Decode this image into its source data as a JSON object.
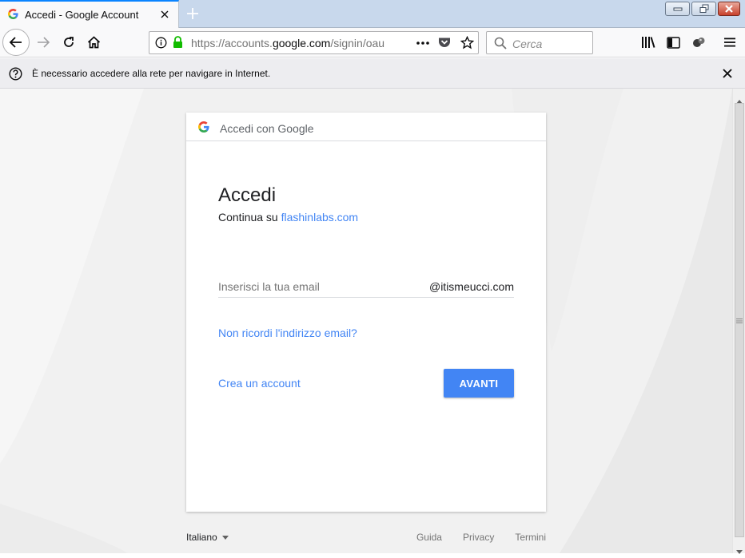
{
  "browser": {
    "tab": {
      "title": "Accedi - Google Account"
    },
    "url": {
      "prefix": "https://accounts.",
      "host": "google.com",
      "path": "/signin/oauth"
    },
    "search_placeholder": "Cerca",
    "notification": "È necessario accedere alla rete per navigare in Internet."
  },
  "card": {
    "header": "Accedi con Google",
    "title": "Accedi",
    "continue_prefix": "Continua su",
    "continue_link": "flashinlabs.com",
    "email_placeholder": "Inserisci la tua email",
    "email_domain": "@itismeucci.com",
    "forgot_link": "Non ricordi l'indirizzo email?",
    "create_account": "Crea un account",
    "next_button": "AVANTI"
  },
  "footer": {
    "language": "Italiano",
    "links": [
      "Guida",
      "Privacy",
      "Termini"
    ]
  },
  "colors": {
    "accent": "#4285f4",
    "firefox_blue": "#0a84ff"
  }
}
